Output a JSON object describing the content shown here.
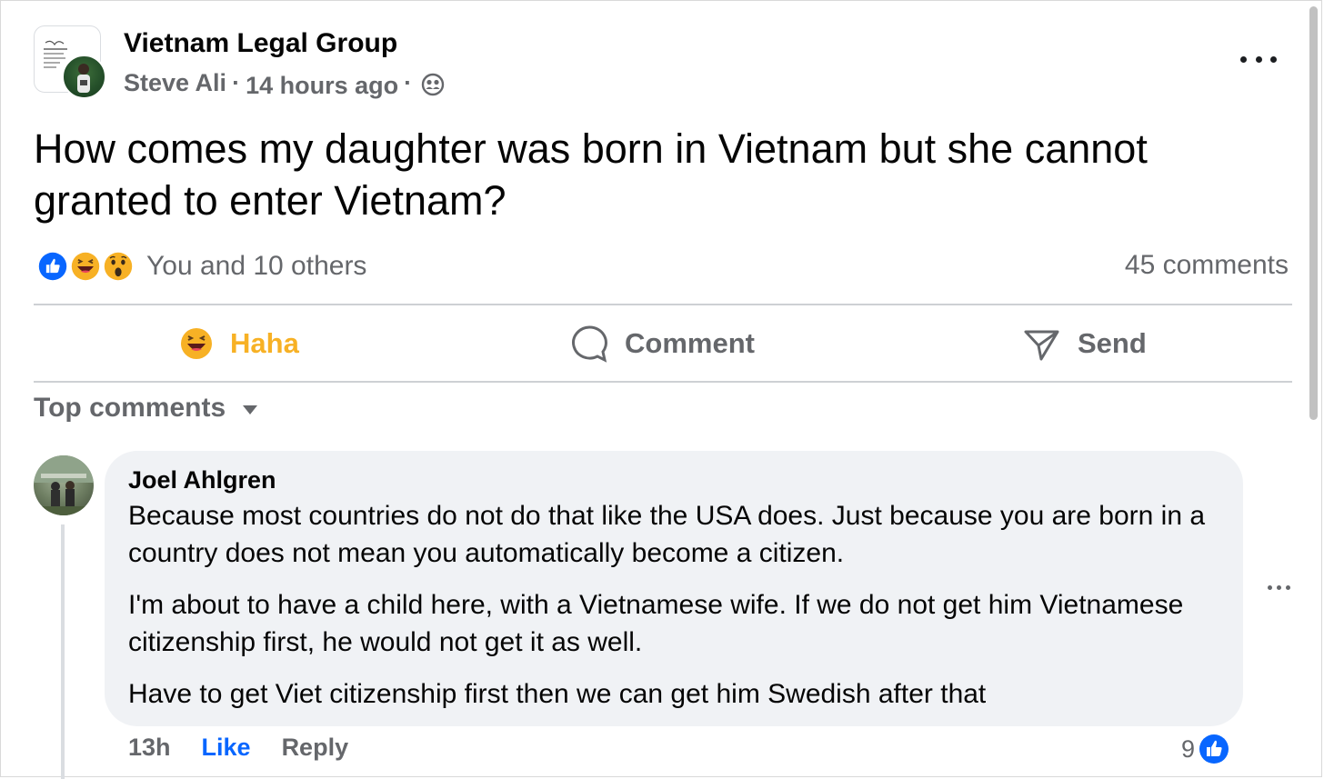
{
  "post": {
    "group_name": "Vietnam Legal Group",
    "author": "Steve Ali",
    "separator": "·",
    "time": "14 hours ago",
    "audience_icon": "group-audience-icon",
    "text": "How comes my daughter was born in Vietnam but she cannot granted to enter Vietnam?",
    "reactions_text": "You and 10 others",
    "comments_count": "45 comments",
    "reaction_icons": [
      "like-icon",
      "haha-icon",
      "wow-icon"
    ]
  },
  "actions": {
    "haha_label": "Haha",
    "comment_label": "Comment",
    "send_label": "Send"
  },
  "comments_header": {
    "label": "Top comments"
  },
  "comment": {
    "author": "Joel Ahlgren",
    "paragraphs": [
      "Because most countries do not do that like the USA does. Just because you are born in a country does not mean you automatically become a citizen.",
      "I'm about to have a child here, with a Vietnamese wife. If we do not get him Vietnamese citizenship first, he would not get it as well.",
      "Have to get Viet citizenship first then we can get him Swedish after that"
    ],
    "time": "13h",
    "like_label": "Like",
    "reply_label": "Reply",
    "like_count": "9"
  },
  "colors": {
    "like_blue": "#0866ff",
    "haha_yellow": "#f7b125",
    "secondary_text": "#65676b",
    "bubble_bg": "#f0f2f5"
  }
}
